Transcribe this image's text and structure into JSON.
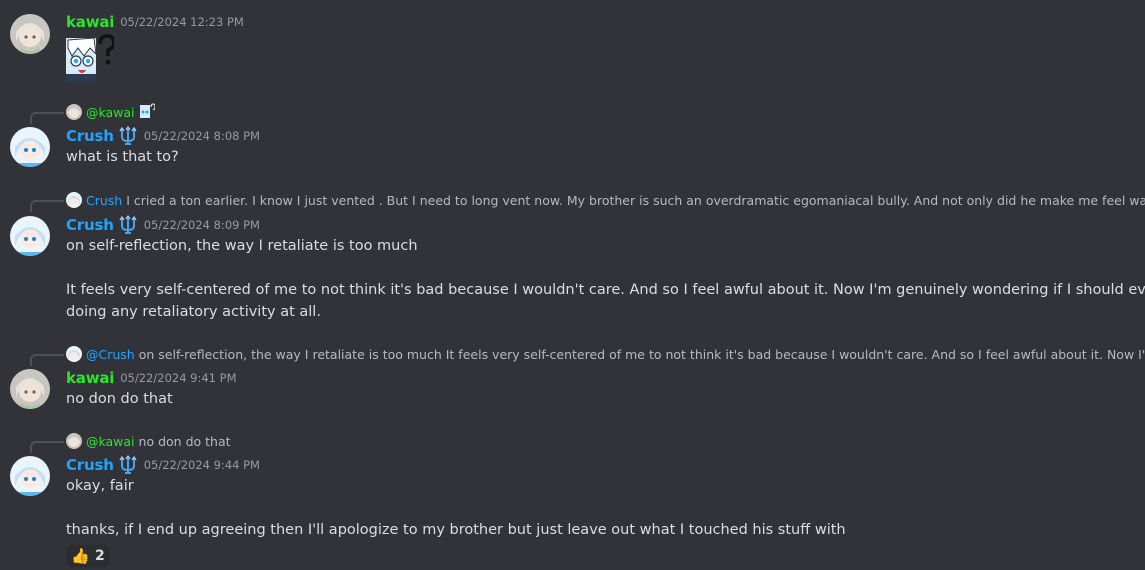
{
  "messages": [
    {
      "author": "kawai",
      "timestamp": "05/22/2024 12:23 PM",
      "sticker": "confused-girl-sticker"
    },
    {
      "reply": {
        "mention": "@kawai",
        "text": "",
        "attachment_icon": "sticker-thumb-icon"
      },
      "author": "Crush",
      "timestamp": "05/22/2024 8:08 PM",
      "lines": [
        "what is that to?"
      ]
    },
    {
      "reply": {
        "author": "Crush",
        "text": "I cried a ton earlier. I know I just vented . But I need to long vent now. My brother is such an overdramatic egomaniacal bully. And not only did he make me feel way ...",
        "attachment_icon": "image-icon"
      },
      "author": "Crush",
      "timestamp": "05/22/2024 8:09 PM",
      "lines": [
        "on self-reflection, the way I retaliate is too much",
        "It feels very self-centered of me to not think it's bad because I wouldn't care. And so I feel awful about it.  Now I'm genuinely wondering if I should even be",
        "doing any retaliatory activity at all."
      ]
    },
    {
      "reply": {
        "mention": "@Crush",
        "text": "on self-reflection, the way I retaliate is too much  It feels very self-centered of me to not think it's bad because I wouldn't care. And so I feel awful about it.  Now I'm ..."
      },
      "author": "kawai",
      "timestamp": "05/22/2024 9:41 PM",
      "lines": [
        "no don do that"
      ]
    },
    {
      "reply": {
        "mention": "@kawai",
        "text": "no don do that"
      },
      "author": "Crush",
      "timestamp": "05/22/2024 9:44 PM",
      "lines": [
        "okay, fair",
        "thanks, if I end up agreeing then I'll apologize to my brother but just leave out what I touched his stuff with"
      ],
      "reaction": {
        "emoji": "👍",
        "count": "2"
      }
    }
  ],
  "colors": {
    "background": "#313338",
    "kawai": "#2be52b",
    "crush": "#1fa5ff",
    "text": "#dbdee1",
    "muted": "#949ba4"
  }
}
